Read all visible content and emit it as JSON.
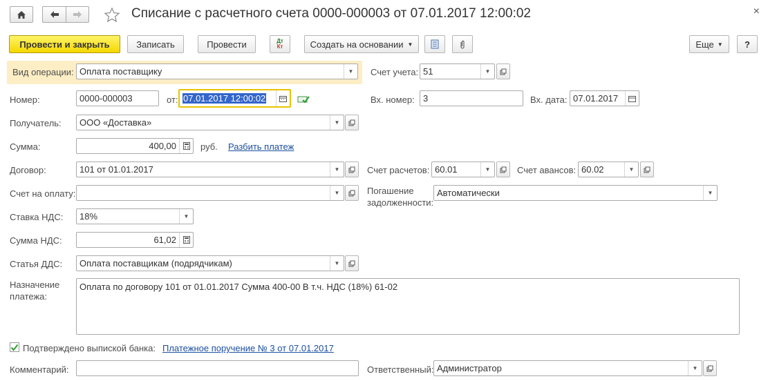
{
  "window": {
    "title": "Списание с расчетного счета 0000-000003 от 07.01.2017 12:00:02",
    "close_symbol": "×"
  },
  "nav": {
    "home_icon": "home-icon",
    "back_icon": "arrow-left-icon",
    "forward_icon": "arrow-right-icon",
    "favorite_icon": "star-icon"
  },
  "toolbar": {
    "post_and_close": "Провести и закрыть",
    "save": "Записать",
    "post": "Провести",
    "dt_kt_line1": "Дт",
    "dt_kt_line2": "Кт",
    "create_based_on": "Создать на основании",
    "more": "Еще",
    "help": "?"
  },
  "form": {
    "operation_type": {
      "label": "Вид операции:",
      "value": "Оплата поставщику"
    },
    "account": {
      "label": "Счет учета:",
      "value": "51"
    },
    "number": {
      "label": "Номер:",
      "value": "0000-000003"
    },
    "date": {
      "label": "от:",
      "value": "07.01.2017 12:00:02"
    },
    "incoming_number": {
      "label": "Вх. номер:",
      "value": "3"
    },
    "incoming_date": {
      "label": "Вх. дата:",
      "value": "07.01.2017"
    },
    "recipient": {
      "label": "Получатель:",
      "value": "ООО  «Доставка»"
    },
    "amount": {
      "label": "Сумма:",
      "value": "400,00",
      "currency": "руб.",
      "split_link": "Разбить платеж"
    },
    "contract": {
      "label": "Договор:",
      "value": "101 от 01.01.2017"
    },
    "settlement_account": {
      "label": "Счет расчетов:",
      "value": "60.01"
    },
    "advance_account": {
      "label": "Счет авансов:",
      "value": "60.02"
    },
    "invoice": {
      "label": "Счет на оплату:",
      "value": ""
    },
    "debt_repayment": {
      "label_line1": "Погашение",
      "label_line2": "задолженности:",
      "value": "Автоматически"
    },
    "vat_rate": {
      "label": "Ставка НДС:",
      "value": "18%"
    },
    "vat_amount": {
      "label": "Сумма НДС:",
      "value": "61,02"
    },
    "cash_flow_item": {
      "label": "Статья ДДС:",
      "value": "Оплата поставщикам (подрядчикам)"
    },
    "purpose": {
      "label_line1": "Назначение",
      "label_line2": "платежа:",
      "value": "Оплата по договору 101 от 01.01.2017 Сумма 400-00 В т.ч. НДС  (18%) 61-02"
    },
    "bank_confirmed": {
      "label": "Подтверждено выпиской банка:",
      "checked": true,
      "link": "Платежное поручение № 3 от 07.01.2017"
    },
    "comment": {
      "label": "Комментарий:",
      "value": ""
    },
    "responsible": {
      "label": "Ответственный:",
      "value": "Администратор"
    }
  },
  "colors": {
    "primary_button": "#f4d800",
    "operation_highlight": "#fdeec6",
    "link": "#1a4fa0",
    "selection": "#3366cc",
    "focus_border": "#e8c300"
  }
}
